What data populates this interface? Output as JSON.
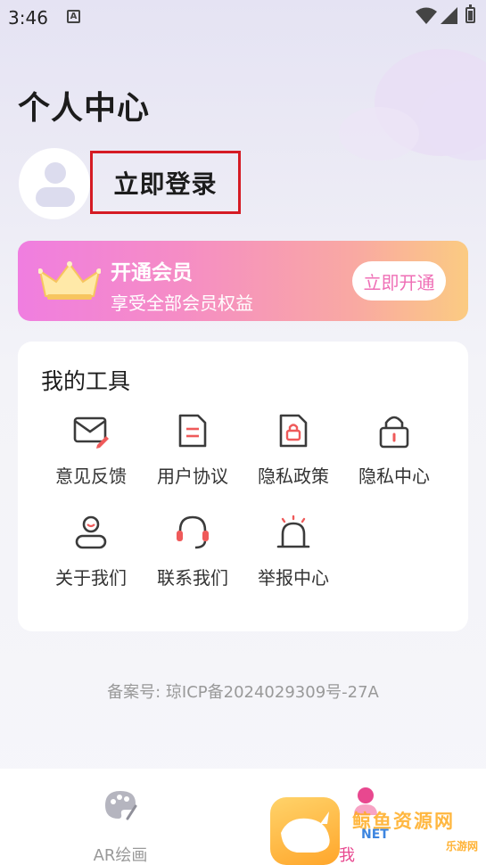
{
  "status_bar": {
    "time": "3:46",
    "notif_letter": "A"
  },
  "page_title": "个人中心",
  "profile": {
    "login_label": "立即登录"
  },
  "vip": {
    "title": "开通会员",
    "subtitle": "享受全部会员权益",
    "button_label": "立即开通"
  },
  "tools": {
    "title": "我的工具",
    "items": [
      {
        "label": "意见反馈",
        "icon": "feedback-mail-icon"
      },
      {
        "label": "用户协议",
        "icon": "document-icon"
      },
      {
        "label": "隐私政策",
        "icon": "document-lock-icon"
      },
      {
        "label": "隐私中心",
        "icon": "lock-icon"
      },
      {
        "label": "关于我们",
        "icon": "user-icon"
      },
      {
        "label": "联系我们",
        "icon": "headset-icon"
      },
      {
        "label": "举报中心",
        "icon": "alarm-icon"
      }
    ]
  },
  "icp": "备案号: 琼ICP备2024029309号-27A",
  "tabbar": {
    "tab_ar": "AR绘画",
    "tab_me": "我",
    "watermark": "鲸鱼资源网",
    "watermark_site": "NET",
    "watermark_sub": "乐游网"
  },
  "colors": {
    "accent": "#ef6fb6",
    "login_box": "#d51b24",
    "tool_stroke": "#3b3b3b",
    "tool_accent": "#ef5a5a"
  }
}
